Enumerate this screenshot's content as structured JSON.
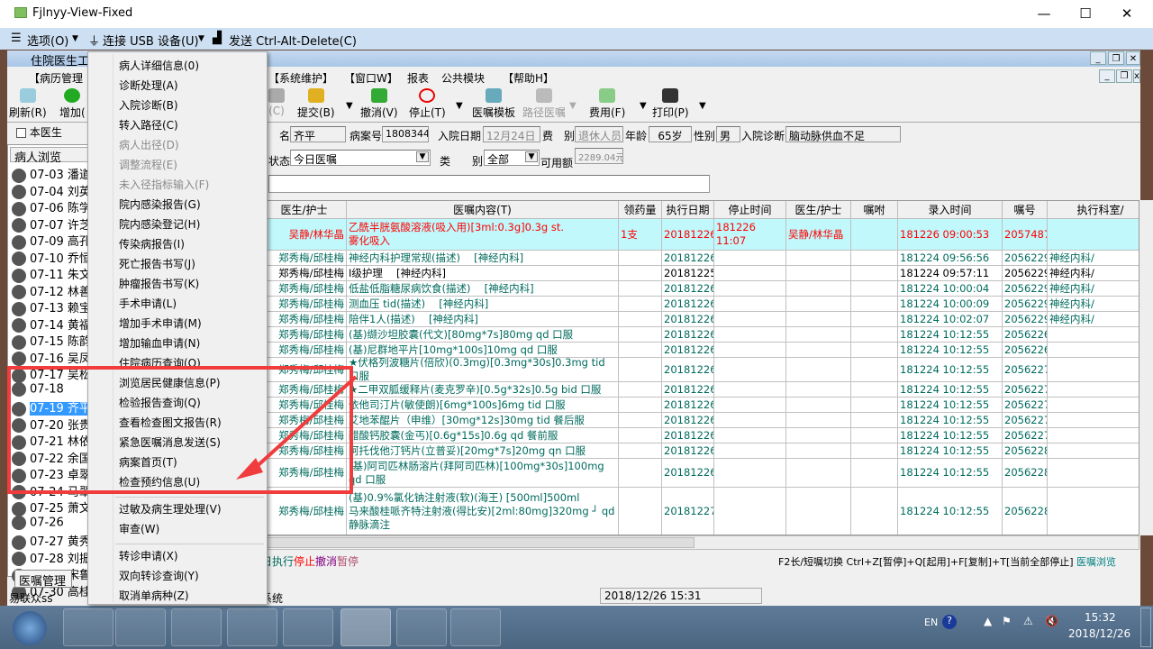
{
  "window": {
    "title": "Fjlnyy-View-Fixed"
  },
  "remote_menu": {
    "options": "选项(O)",
    "usb": "连接 USB 设备(U)",
    "cad": "发送 Ctrl-Alt-Delete(C)"
  },
  "app": {
    "title": "住院医生工",
    "menus": [
      "【病历管理",
      "【系统维护】",
      "【窗口W】",
      "报表",
      "公共模块",
      "【帮助H】"
    ]
  },
  "toolbar": [
    {
      "label": "刷新(R)"
    },
    {
      "label": "增加("
    },
    {
      "label": "(C)",
      "disabled": true
    },
    {
      "label": "提交(B)"
    },
    {
      "label": "撤消(V)"
    },
    {
      "label": "停止(T)"
    },
    {
      "label": "医嘱模板"
    },
    {
      "label": "路径医嘱",
      "disabled": true
    },
    {
      "label": "费用(F)"
    },
    {
      "label": "打印(P)"
    }
  ],
  "filter": {
    "own_doctor": "本医生",
    "patient_browse": "病人浏览"
  },
  "patient_info": {
    "name_label": "名",
    "name": "齐平",
    "case_label": "病案号",
    "case_no": "1808344",
    "admit_label": "入院日期",
    "admit_date": "12月24日",
    "fee_label": "费　别",
    "fee_type": "退休人员",
    "age_label": "年龄",
    "age": "65岁",
    "sex_label": "性别",
    "sex": "男",
    "diag_label": "入院诊断",
    "diagnosis": "脑动脉供血不足",
    "status_label": "状态",
    "status": "今日医嘱",
    "type_label1": "类",
    "type_label2": "别",
    "type": "全部",
    "avail_label": "可用额",
    "available": "2289.04元"
  },
  "patients": [
    {
      "id": "07-03",
      "name": "潘道"
    },
    {
      "id": "07-04",
      "name": "刘英"
    },
    {
      "id": "07-06",
      "name": "陈学"
    },
    {
      "id": "07-07",
      "name": "许芝"
    },
    {
      "id": "07-09",
      "name": "高孔"
    },
    {
      "id": "07-10",
      "name": "乔恒"
    },
    {
      "id": "07-11",
      "name": "朱文"
    },
    {
      "id": "07-12",
      "name": "林善"
    },
    {
      "id": "07-13",
      "name": "赖宝"
    },
    {
      "id": "07-14",
      "name": "黄福"
    },
    {
      "id": "07-15",
      "name": "陈韵"
    },
    {
      "id": "07-16",
      "name": "吴凤"
    },
    {
      "id": "07-17",
      "name": "吴松"
    },
    {
      "id": "07-18",
      "name": ""
    },
    {
      "id": "07-19",
      "name": "齐平",
      "selected": true
    },
    {
      "id": "07-20",
      "name": "张贵"
    },
    {
      "id": "07-21",
      "name": "林依"
    },
    {
      "id": "07-22",
      "name": "余国"
    },
    {
      "id": "07-23",
      "name": "卓翠"
    },
    {
      "id": "07-24",
      "name": "马翠"
    },
    {
      "id": "07-25",
      "name": "萧文"
    },
    {
      "id": "07-26",
      "name": ""
    },
    {
      "id": "07-27",
      "name": "黄秀"
    },
    {
      "id": "07-28",
      "name": "刘振"
    },
    {
      "id": "07-29",
      "name": "宋鲁"
    },
    {
      "id": "07-30",
      "name": "高桂"
    }
  ],
  "left_tab": "医嘱管理",
  "left_status": "易联众ss",
  "grid": {
    "columns": [
      "医生/护士",
      "医嘱内容(T)",
      "领药量",
      "执行日期",
      "停止时间",
      "医生/护士",
      "嘱咐",
      "录入时间",
      "嘱号",
      "执行科室/"
    ],
    "rows": [
      [
        "吴静/林华晶",
        "乙酰半胱氨酸溶液(吸入用)[3ml:0.3g]0.3g st.\n雾化吸入",
        "1支",
        "20181226",
        "181226 11:07",
        "吴静/林华晶",
        "",
        "181226 09:00:53",
        "20574878",
        ""
      ],
      [
        "郑秀梅/邱桂梅",
        "神经内科护理常规(描述)　 [神经内科]",
        "",
        "20181226",
        "",
        "",
        "",
        "181224 09:56:56",
        "20562290",
        "神经内科/"
      ],
      [
        "郑秀梅/邱桂梅",
        "Ⅰ级护理　 [神经内科]",
        "",
        "20181225",
        "",
        "",
        "",
        "181224 09:57:11",
        "20562291",
        "神经内科/"
      ],
      [
        "郑秀梅/邱桂梅",
        "低盐低脂糖尿病饮食(描述)　 [神经内科]",
        "",
        "20181226",
        "",
        "",
        "",
        "181224 10:00:04",
        "20562292",
        "神经内科/"
      ],
      [
        "郑秀梅/邱桂梅",
        "测血压 tid(描述)　 [神经内科]",
        "",
        "20181226",
        "",
        "",
        "",
        "181224 10:00:09",
        "20562293",
        "神经内科/"
      ],
      [
        "郑秀梅/邱桂梅",
        "陪伴1人(描述)　 [神经内科]",
        "",
        "20181226",
        "",
        "",
        "",
        "181224 10:02:07",
        "20562294",
        "神经内科/"
      ],
      [
        "郑秀梅/邱桂梅",
        "(基)缬沙坦胶囊(代文)[80mg*7s]80mg qd 口服",
        "",
        "20181226",
        "",
        "",
        "",
        "181224 10:12:55",
        "20562266",
        ""
      ],
      [
        "郑秀梅/邱桂梅",
        "(基)尼群地平片[10mg*100s]10mg qd 口服",
        "",
        "20181226",
        "",
        "",
        "",
        "181224 10:12:55",
        "20562268",
        ""
      ],
      [
        "郑秀梅/邱桂梅",
        "★伏格列波糖片(倍欣)(0.3mg)[0.3mg*30s]0.3mg tid 口服",
        "",
        "20181226",
        "",
        "",
        "",
        "181224 10:12:55",
        "20562270",
        ""
      ],
      [
        "郑秀梅/邱桂梅",
        "★二甲双胍缓释片(麦克罗辛)[0.5g*32s]0.5g bid 口服",
        "",
        "20181226",
        "",
        "",
        "",
        "181224 10:12:55",
        "20562272",
        ""
      ],
      [
        "郑秀梅/邱桂梅",
        "依他司汀片(敏使朗)[6mg*100s]6mg tid 口服",
        "",
        "20181226",
        "",
        "",
        "",
        "181224 10:12:55",
        "20562274",
        ""
      ],
      [
        "郑秀梅/邱桂梅",
        "艾地苯醌片（申维）[30mg*12s]30mg tid 餐后服",
        "",
        "20181226",
        "",
        "",
        "",
        "181224 10:12:55",
        "20562276",
        ""
      ],
      [
        "郑秀梅/邱桂梅",
        "醋酸钙胶囊(金丐)[0.6g*15s]0.6g qd 餐前服",
        "",
        "20181226",
        "",
        "",
        "",
        "181224 10:12:55",
        "20562278",
        ""
      ],
      [
        "郑秀梅/邱桂梅",
        "阿托伐他汀钙片(立普妥)[20mg*7s]20mg qn 口服",
        "",
        "20181226",
        "",
        "",
        "",
        "181224 10:12:55",
        "20562280",
        ""
      ],
      [
        "郑秀梅/邱桂梅",
        "(基)阿司匹林肠溶片(拜阿司匹林)[100mg*30s]100mg qd 口服",
        "",
        "20181226",
        "",
        "",
        "",
        "181224 10:12:55",
        "20562282",
        ""
      ],
      [
        "郑秀梅/邱桂梅",
        "(基)0.9%氯化钠注射液(软)(海王) [500ml]500ml\n马来酸桂哌齐特注射液(得比安)[2ml:80mg]320mg ┘ qd 静脉滴注",
        "",
        "20181227",
        "",
        "",
        "",
        "181224 10:12:55",
        "20562284",
        ""
      ]
    ]
  },
  "legend": [
    {
      "text": "日执行",
      "color": "#006b5e"
    },
    {
      "text": "停止",
      "color": "#ff0000"
    },
    {
      "text": "撤消",
      "color": "#800080"
    },
    {
      "text": "暂停",
      "color": "#b05070"
    }
  ],
  "hint": "F2长/短嘱切换 Ctrl+Z[暂停]+Q[起用]+F[复制]+T[当前全部停止]",
  "hint_link": "医嘱浏览",
  "statusbar": {
    "left": "系统",
    "datetime": "2018/12/26 15:31"
  },
  "context_menu": [
    {
      "label": "病人详细信息(0)"
    },
    {
      "label": "诊断处理(A)"
    },
    {
      "label": "入院诊断(B)"
    },
    {
      "label": "转入路径(C)"
    },
    {
      "label": "病人出径(D)",
      "disabled": true
    },
    {
      "label": "调整流程(E)",
      "disabled": true
    },
    {
      "label": "未入径指标输入(F)",
      "disabled": true
    },
    {
      "label": "院内感染报告(G)"
    },
    {
      "label": "院内感染登记(H)"
    },
    {
      "label": "传染病报告(I)"
    },
    {
      "label": "死亡报告书写(J)"
    },
    {
      "label": "肿瘤报告书写(K)"
    },
    {
      "label": "手术申请(L)"
    },
    {
      "label": "增加手术申请(M)"
    },
    {
      "label": "增加输血申请(N)"
    },
    {
      "label": "住院病历查询(O)"
    },
    {
      "label": "浏览居民健康信息(P)"
    },
    {
      "label": "检验报告查询(Q)"
    },
    {
      "label": "查看检查图文报告(R)"
    },
    {
      "label": "紧急医嘱消息发送(S)"
    },
    {
      "label": "病案首页(T)"
    },
    {
      "label": "检查预约信息(U)"
    },
    {
      "label": "过敏及病生理处理(V)"
    },
    {
      "label": "审查(W)"
    },
    {
      "label": "转诊申请(X)"
    },
    {
      "label": "双向转诊查询(Y)"
    },
    {
      "label": "取消单病种(Z)"
    }
  ],
  "tray": {
    "lang": "EN",
    "time": "15:32",
    "date": "2018/12/26"
  },
  "colors": {
    "teal": "#006b5e",
    "red": "#ff0000",
    "highlight_row": "#c0f8fc",
    "annotation": "#f03c3c"
  }
}
